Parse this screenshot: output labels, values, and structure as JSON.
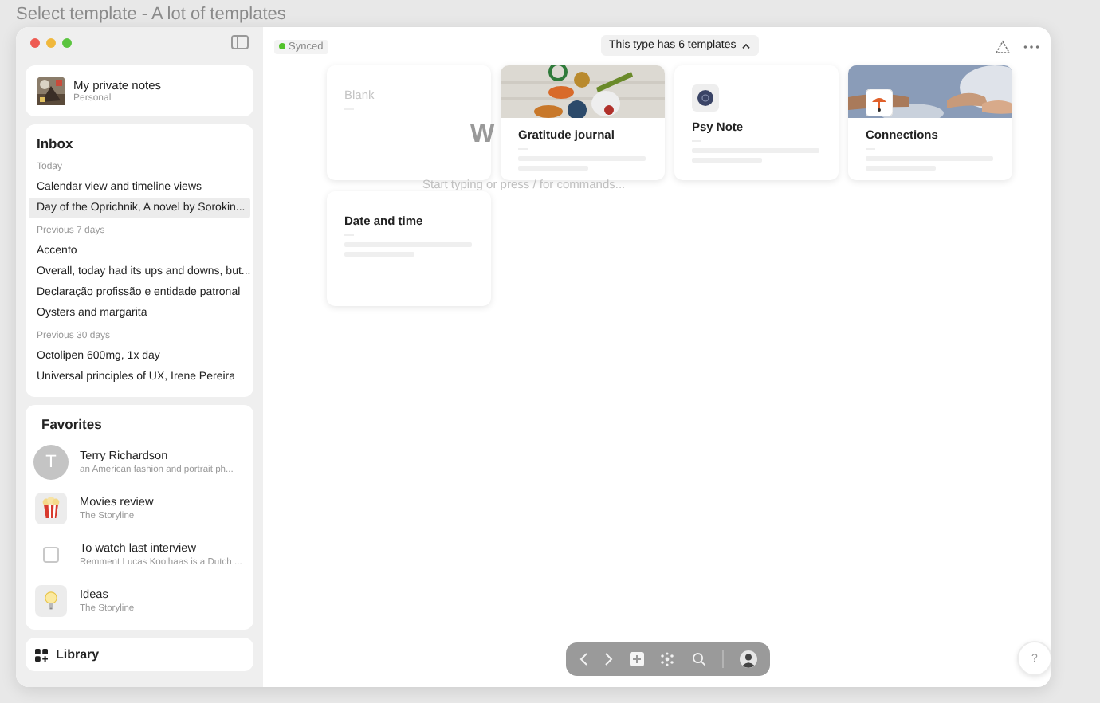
{
  "page_title": "Select template - A lot of templates",
  "sidebar": {
    "workspace": {
      "name": "My private notes",
      "subtitle": "Personal"
    },
    "inbox": {
      "title": "Inbox",
      "groups": [
        {
          "label": "Today",
          "items": [
            {
              "title": "Calendar view and timeline views",
              "selected": false
            },
            {
              "title": "Day of the Oprichnik, A novel by Sorokin...",
              "selected": true
            }
          ]
        },
        {
          "label": "Previous 7 days",
          "items": [
            {
              "title": "Accento",
              "selected": false
            },
            {
              "title": "Overall, today had its ups and downs, but...",
              "selected": false
            },
            {
              "title": "Declaração profissão e entidade patronal",
              "selected": false
            },
            {
              "title": "Oysters and margarita",
              "selected": false
            }
          ]
        },
        {
          "label": "Previous 30 days",
          "items": [
            {
              "title": "Octolipen 600mg, 1x day",
              "selected": false
            },
            {
              "title": "Universal principles of UX, Irene Pereira",
              "selected": false
            }
          ]
        }
      ]
    },
    "favorites": {
      "title": "Favorites",
      "items": [
        {
          "kind": "letter",
          "letter": "T",
          "title": "Terry Richardson",
          "subtitle": "an American fashion and portrait ph..."
        },
        {
          "kind": "popcorn",
          "title": "Movies review",
          "subtitle": "The Storyline"
        },
        {
          "kind": "checkbox",
          "checked": false,
          "title": "To watch last interview",
          "subtitle": "Remment Lucas Koolhaas is a Dutch ..."
        },
        {
          "kind": "bulb",
          "title": "Ideas",
          "subtitle": "The Storyline"
        }
      ]
    },
    "library": {
      "label": "Library"
    }
  },
  "main": {
    "sync_status": "Synced",
    "template_toggle": {
      "label": "This type has 6 templates",
      "expanded": true
    },
    "editor": {
      "title_fragment": "W",
      "placeholder": "Start typing or press / for commands..."
    },
    "templates": [
      {
        "kind": "blank",
        "name": "Blank"
      },
      {
        "kind": "cover",
        "name": "Gratitude journal"
      },
      {
        "kind": "icon",
        "name": "Psy Note"
      },
      {
        "kind": "cover_icon",
        "name": "Connections"
      },
      {
        "kind": "plain",
        "name": "Date and time"
      }
    ],
    "help": "?"
  }
}
